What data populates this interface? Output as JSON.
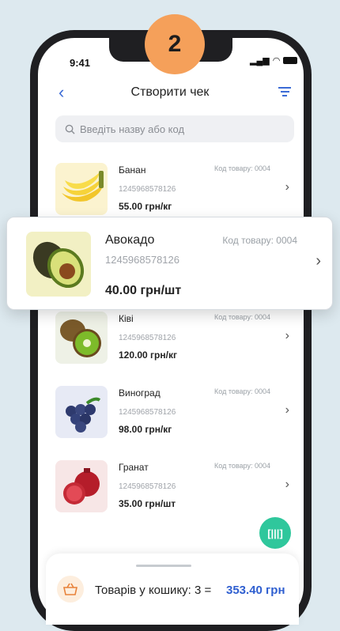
{
  "step_badge": "2",
  "status_bar": {
    "time": "9:41"
  },
  "nav": {
    "title": "Створити чек"
  },
  "search": {
    "placeholder": "Введіть назву або код"
  },
  "highlighted_item": {
    "name": "Авокадо",
    "code": "Код товару: 0004",
    "barcode": "1245968578126",
    "price": "40.00 грн/шт"
  },
  "items": [
    {
      "name": "Банан",
      "code": "Код товару: 0004",
      "barcode": "1245968578126",
      "price": "55.00 грн/кг"
    },
    {
      "name": "Ківі",
      "code": "Код товару: 0004",
      "barcode": "1245968578126",
      "price": "120.00 грн/кг"
    },
    {
      "name": "Виноград",
      "code": "Код товару: 0004",
      "barcode": "1245968578126",
      "price": "98.00 грн/кг"
    },
    {
      "name": "Гранат",
      "code": "Код товару: 0004",
      "barcode": "1245968578126",
      "price": "35.00 грн/шт"
    }
  ],
  "cart": {
    "label": "Товарів у кошику: 3 =",
    "total": "353.40 грн"
  },
  "colors": {
    "accent": "#3b6bd6",
    "scan": "#2fc79c",
    "badge": "#f5a05a"
  }
}
